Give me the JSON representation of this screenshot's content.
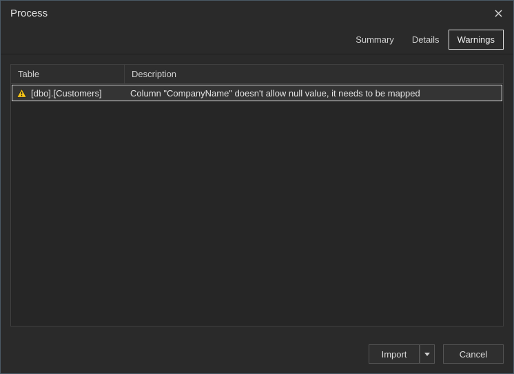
{
  "window": {
    "title": "Process"
  },
  "tabs": {
    "summary": "Summary",
    "details": "Details",
    "warnings": "Warnings",
    "active": "warnings"
  },
  "grid": {
    "headers": {
      "table": "Table",
      "description": "Description"
    },
    "rows": [
      {
        "icon": "warning",
        "table": "[dbo].[Customers]",
        "description": "Column \"CompanyName\" doesn't allow null value, it needs to be mapped"
      }
    ]
  },
  "buttons": {
    "import": "Import",
    "cancel": "Cancel"
  }
}
